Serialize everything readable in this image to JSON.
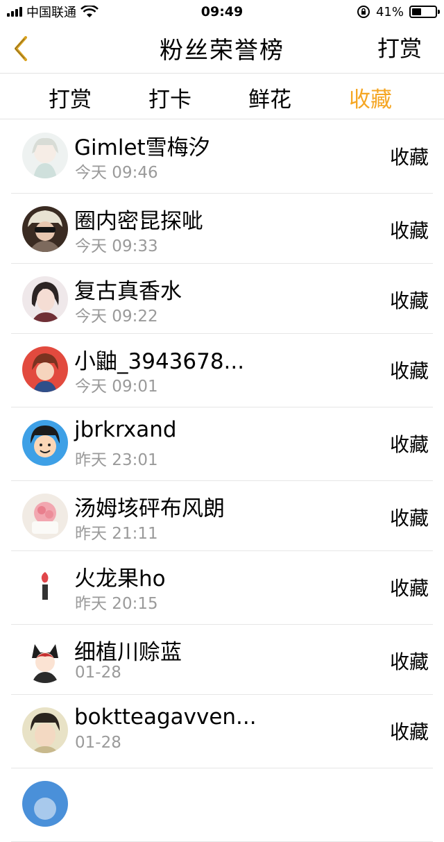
{
  "status_bar": {
    "carrier": "中国联通",
    "time": "09:49",
    "battery": "41%",
    "battery_level": 0.41
  },
  "nav": {
    "title": "粉丝荣誉榜",
    "right_label": "打赏"
  },
  "tabs": [
    {
      "label": "打赏",
      "active": false
    },
    {
      "label": "打卡",
      "active": false
    },
    {
      "label": "鲜花",
      "active": false
    },
    {
      "label": "收藏",
      "active": true
    }
  ],
  "colors": {
    "accent": "#f5a623",
    "divider": "#e6e6e6",
    "secondary_text": "#9a9a9a"
  },
  "fans": [
    {
      "name": "Gimlet雪梅汐",
      "time": "今天 09:46",
      "action": "收藏"
    },
    {
      "name": "圈内密昆探呲",
      "time": "今天 09:33",
      "action": "收藏"
    },
    {
      "name": "复古真香水",
      "time": "今天 09:22",
      "action": "收藏"
    },
    {
      "name": "小鼬_3943678...",
      "time": "今天 09:01",
      "action": "收藏"
    },
    {
      "name": "jbrkrxand",
      "time": "昨天 23:01",
      "action": "收藏"
    },
    {
      "name": "汤姆垓砰布风朗",
      "time": "昨天 21:11",
      "action": "收藏"
    },
    {
      "name": "火龙果ho",
      "time": "昨天 20:15",
      "action": "收藏"
    },
    {
      "name": "细植川赊蓝",
      "time": "01-28",
      "action": "收藏"
    },
    {
      "name": "boktteagavven...",
      "time": "01-28",
      "action": "收藏"
    }
  ]
}
